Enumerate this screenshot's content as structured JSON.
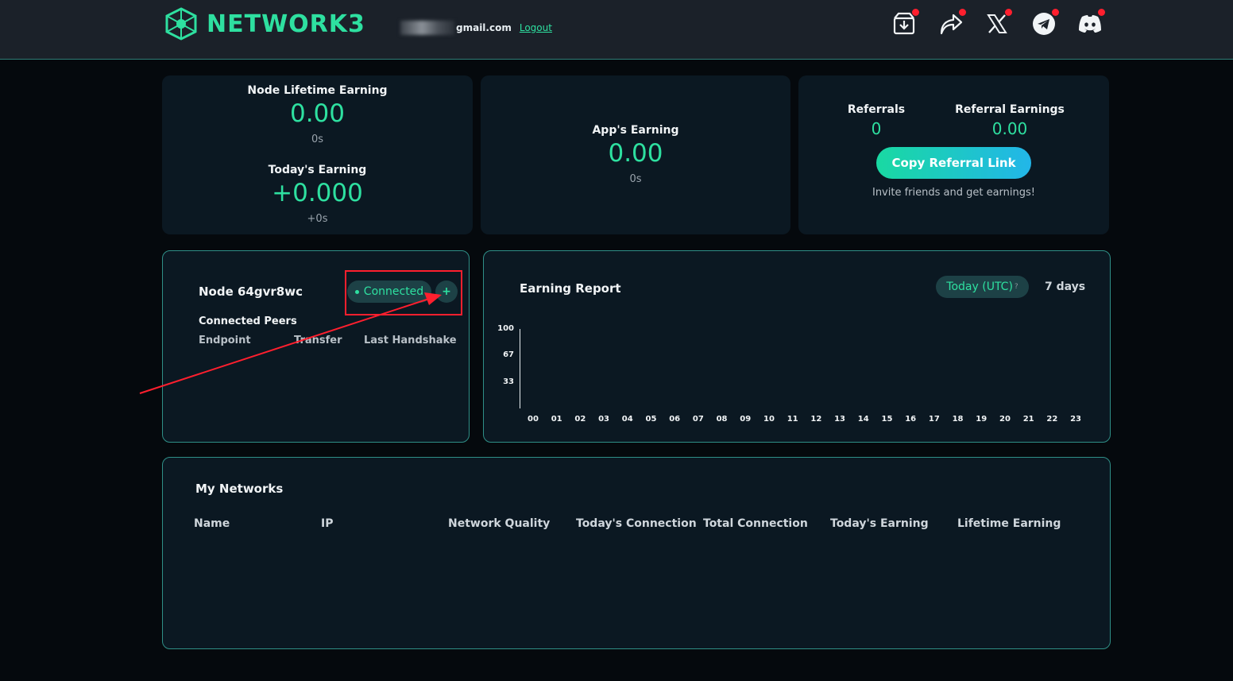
{
  "header": {
    "logo_text": "NETWORK3",
    "user_email": "gmail.com",
    "logout_label": "Logout",
    "icons": [
      "download-icon",
      "share-icon",
      "x-icon",
      "telegram-icon",
      "discord-icon"
    ],
    "notification_color": "#ff1f2e"
  },
  "node_earning": {
    "lifetime_label": "Node Lifetime Earning",
    "lifetime_value": "0.00",
    "lifetime_time": "0s",
    "today_label": "Today's Earning",
    "today_value": "+0.000",
    "today_time": "+0s"
  },
  "app_earning": {
    "label": "App's Earning",
    "value": "0.00",
    "time": "0s"
  },
  "referral": {
    "referrals_label": "Referrals",
    "referrals_value": "0",
    "earnings_label": "Referral Earnings",
    "earnings_value": "0.00",
    "copy_button": "Copy Referral Link",
    "invite_text": "Invite friends and get earnings!"
  },
  "node": {
    "title": "Node 64gvr8wc",
    "status": "Connected",
    "add_label": "+",
    "peers_label": "Connected Peers",
    "columns": [
      "Endpoint",
      "Transfer",
      "Last Handshake"
    ]
  },
  "earning_report": {
    "title": "Earning Report",
    "range_today": "Today (UTC)",
    "range_today_help": "?",
    "range_7days": "7 days"
  },
  "chart_data": {
    "type": "bar",
    "categories": [
      "00",
      "01",
      "02",
      "03",
      "04",
      "05",
      "06",
      "07",
      "08",
      "09",
      "10",
      "11",
      "12",
      "13",
      "14",
      "15",
      "16",
      "17",
      "18",
      "19",
      "20",
      "21",
      "22",
      "23"
    ],
    "values": [],
    "ytick_labels": [
      "100",
      "67",
      "33"
    ],
    "title": "",
    "xlabel": "",
    "ylabel": "",
    "ylim": [
      0,
      100
    ]
  },
  "networks": {
    "title": "My Networks",
    "columns": [
      "Name",
      "IP",
      "Network Quality",
      "Today's Connection",
      "Total Connection",
      "Today's Earning",
      "Lifetime Earning"
    ]
  },
  "colors": {
    "accent": "#2ee0a0",
    "card_bg": "#0b1822",
    "page_bg": "#05090d",
    "header_bg": "#1b2129",
    "annotation": "#ff1f2e"
  }
}
